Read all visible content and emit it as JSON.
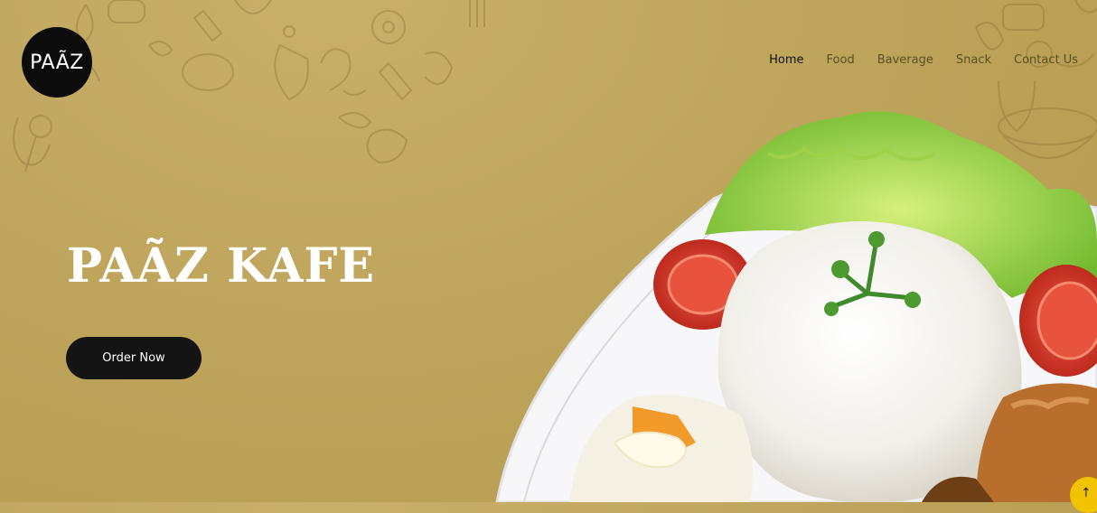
{
  "brand": {
    "logo_text": "PAÃZ"
  },
  "nav": {
    "items": [
      {
        "label": "Home",
        "active": true
      },
      {
        "label": "Food",
        "active": false
      },
      {
        "label": "Baverage",
        "active": false
      },
      {
        "label": "Snack",
        "active": false
      },
      {
        "label": "Contact Us",
        "active": false
      }
    ]
  },
  "hero": {
    "title": "PAÃZ KAFE",
    "cta_label": "Order Now",
    "image_alt": "plate-of-rice-salad-tomato-fried-chicken"
  },
  "scroll_top": {
    "icon": "arrow-up-icon",
    "glyph": "↑"
  },
  "colors": {
    "background": "#bfa55c",
    "button": "#141414",
    "accent": "#f2c300",
    "logo_bg": "#0c0c0c"
  }
}
